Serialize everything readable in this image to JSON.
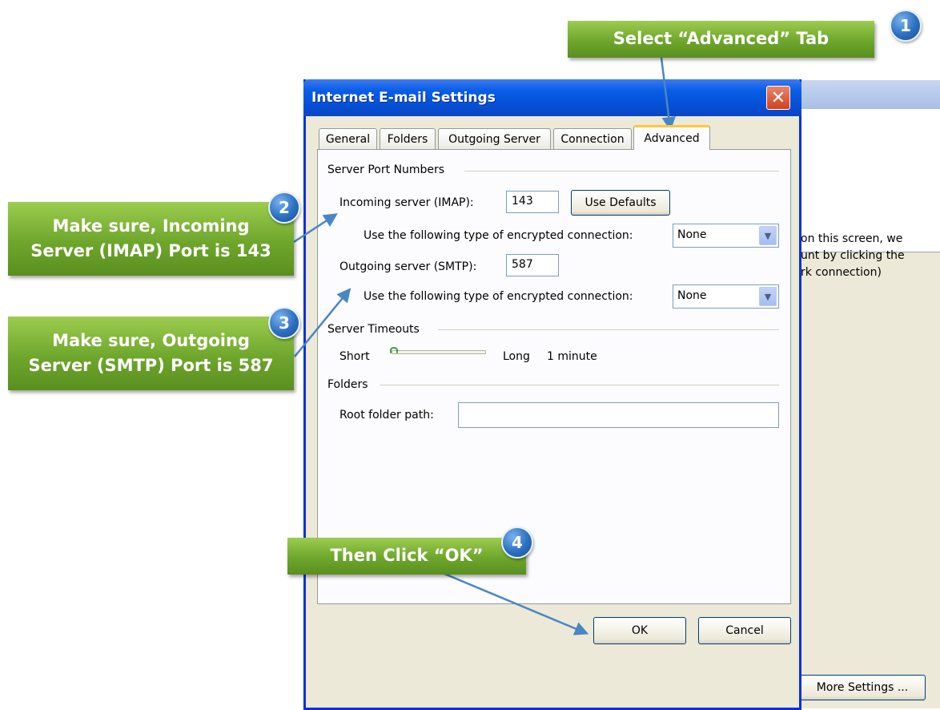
{
  "background": {
    "info_lines": [
      "on this screen, we",
      "unt by clicking the",
      "rk connection)"
    ],
    "more_settings_label": "More Settings ..."
  },
  "dialog": {
    "title": "Internet E-mail Settings",
    "close_icon": "close-icon",
    "tabs": [
      {
        "label": "General"
      },
      {
        "label": "Folders"
      },
      {
        "label": "Outgoing Server"
      },
      {
        "label": "Connection"
      },
      {
        "label": "Advanced",
        "selected": true
      }
    ],
    "ports": {
      "group_label": "Server Port Numbers",
      "incoming_label": "Incoming server (IMAP):",
      "incoming_value": "143",
      "use_defaults_label": "Use Defaults",
      "incoming_encryption_label": "Use the following type of encrypted connection:",
      "incoming_encryption_value": "None",
      "outgoing_label": "Outgoing server (SMTP):",
      "outgoing_value": "587",
      "outgoing_encryption_label": "Use the following type of encrypted connection:",
      "outgoing_encryption_value": "None"
    },
    "timeouts": {
      "group_label": "Server Timeouts",
      "short_label": "Short",
      "long_label": "Long",
      "value_label": "1 minute",
      "slider_level": 0
    },
    "folders": {
      "group_label": "Folders",
      "root_label": "Root folder path:",
      "root_value": ""
    },
    "ok_label": "OK",
    "cancel_label": "Cancel"
  },
  "callouts": {
    "step1": {
      "number": "1",
      "text": "Select “Advanced” Tab"
    },
    "step2": {
      "number": "2",
      "text": "Make sure, Incoming Server (IMAP) Port is 143"
    },
    "step3": {
      "number": "3",
      "text": "Make sure, Outgoing Server (SMTP) Port is 587"
    },
    "step4": {
      "number": "4",
      "text": "Then Click “OK”"
    }
  },
  "colors": {
    "callout_green": "#6ea62c",
    "badge_blue": "#2b6fc2",
    "title_blue": "#0a5de6",
    "arrow_blue": "#4a86c5"
  }
}
